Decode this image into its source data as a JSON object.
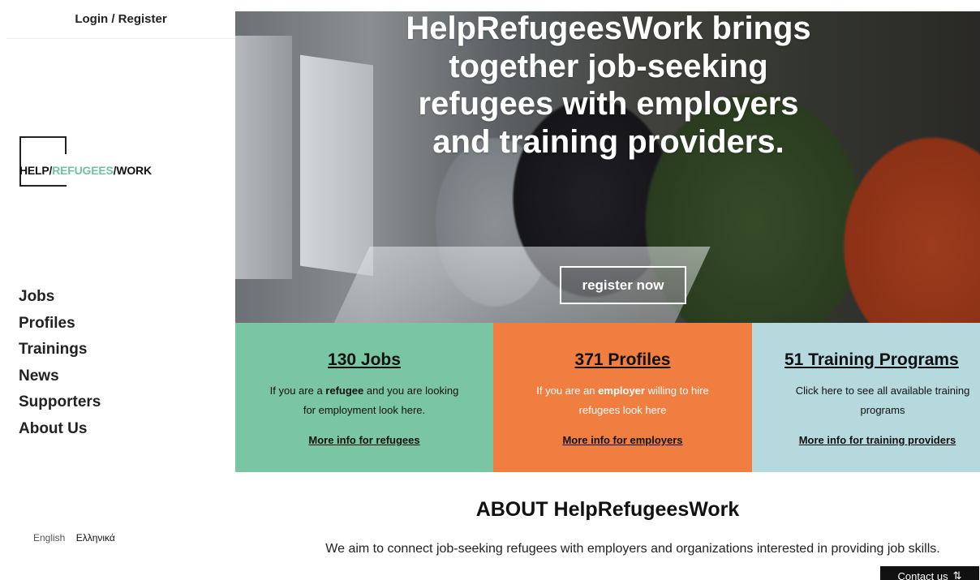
{
  "sidebar": {
    "login": "Login / Register",
    "logo": {
      "part1": "HELP/",
      "part2": "REFUGEES",
      "part3": "/WORK"
    },
    "nav": [
      "Jobs",
      "Profiles",
      "Trainings",
      "News",
      "Supporters",
      "About Us"
    ],
    "lang": {
      "english": "English",
      "greek": "Ελληνικά"
    }
  },
  "hero": {
    "headline": "HelpRefugeesWork brings together job-seeking refugees with employers and training providers.",
    "cta": "register now"
  },
  "stats": {
    "jobs": {
      "title": "130 Jobs",
      "desc_pre": "If you are a ",
      "desc_strong": "refugee",
      "desc_post": " and you are looking for employment look here.",
      "link": "More info for refugees"
    },
    "profiles": {
      "title": "371 Profiles",
      "desc_pre": "If you are an ",
      "desc_strong": "employer",
      "desc_post": " willing to hire refugees look here",
      "link": "More info for employers"
    },
    "trainings": {
      "title": "51 Training Programs",
      "desc": "Click here to see all available training programs",
      "link": "More info for training providers"
    }
  },
  "about": {
    "title": "ABOUT HelpRefugeesWork",
    "text": "We aim to connect job-seeking refugees with employers and organizations interested in providing job skills."
  },
  "contact": {
    "label": "Contact us",
    "icon": "⇅"
  },
  "colors": {
    "accent_green": "#79c5a4",
    "accent_orange": "#f07e40",
    "accent_blue": "#b6d9de",
    "logo_green": "#71c3a0"
  }
}
